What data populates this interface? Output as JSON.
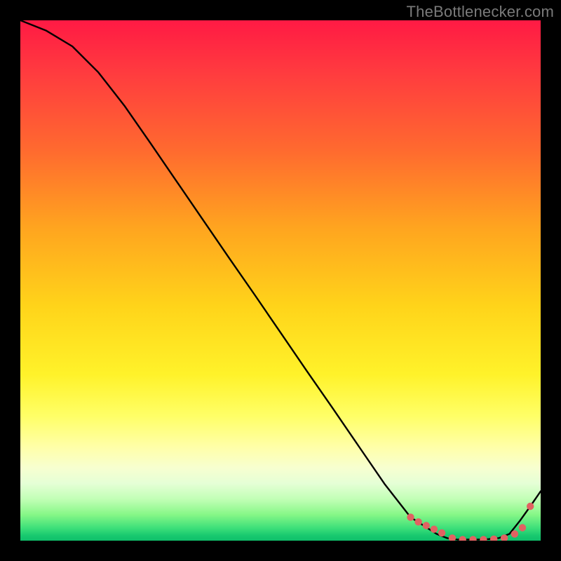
{
  "watermark": "TheBottlenecker.com",
  "chart_data": {
    "type": "line",
    "title": "",
    "xlabel": "",
    "ylabel": "",
    "xlim": [
      0,
      100
    ],
    "ylim": [
      0,
      100
    ],
    "series": [
      {
        "name": "curve",
        "x": [
          0,
          5,
          10,
          15,
          20,
          25,
          30,
          35,
          40,
          45,
          50,
          55,
          60,
          65,
          70,
          75,
          80,
          82,
          84,
          86,
          88,
          90,
          92,
          94,
          96,
          98,
          100
        ],
        "values": [
          100,
          98,
          95,
          90,
          83.6,
          76.4,
          69.1,
          61.8,
          54.5,
          47.3,
          40.0,
          32.7,
          25.5,
          18.2,
          10.9,
          4.5,
          1.3,
          0.5,
          0.2,
          0.2,
          0.2,
          0.3,
          0.5,
          1.3,
          3.8,
          6.6,
          9.5
        ]
      }
    ],
    "markers": {
      "name": "dotted-segments",
      "x": [
        75,
        76.5,
        78,
        79.5,
        81,
        83,
        85,
        87,
        89,
        91,
        93,
        95,
        96.5,
        98
      ],
      "values": [
        4.5,
        3.6,
        2.9,
        2.2,
        1.5,
        0.5,
        0.2,
        0.2,
        0.2,
        0.3,
        0.5,
        1.3,
        2.5,
        6.6
      ]
    },
    "gradient_stops": [
      {
        "pos": 0,
        "color": "#ff1a44"
      },
      {
        "pos": 0.1,
        "color": "#ff3b3f"
      },
      {
        "pos": 0.25,
        "color": "#ff6a2f"
      },
      {
        "pos": 0.4,
        "color": "#ffa51f"
      },
      {
        "pos": 0.55,
        "color": "#ffd41a"
      },
      {
        "pos": 0.68,
        "color": "#fff22a"
      },
      {
        "pos": 0.76,
        "color": "#ffff66"
      },
      {
        "pos": 0.82,
        "color": "#ffffa8"
      },
      {
        "pos": 0.86,
        "color": "#f7ffd0"
      },
      {
        "pos": 0.89,
        "color": "#e5ffd6"
      },
      {
        "pos": 0.92,
        "color": "#c2ffb6"
      },
      {
        "pos": 0.95,
        "color": "#86f787"
      },
      {
        "pos": 0.975,
        "color": "#3fe07a"
      },
      {
        "pos": 0.99,
        "color": "#18c96f"
      },
      {
        "pos": 1.0,
        "color": "#0fbf6a"
      }
    ],
    "colors": {
      "curve": "#000000",
      "marker": "#e16262",
      "background_frame": "#000000"
    }
  }
}
